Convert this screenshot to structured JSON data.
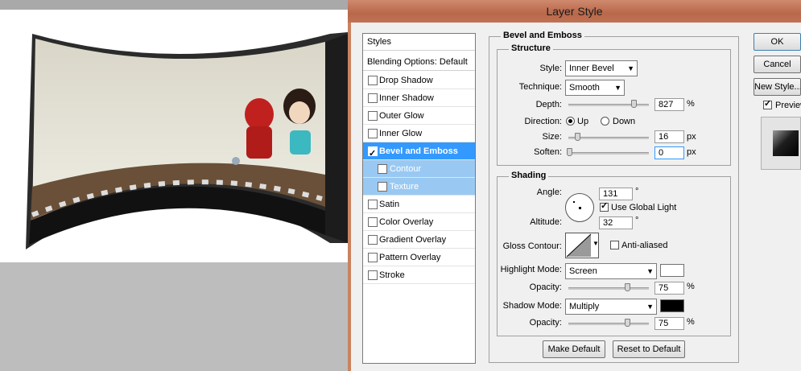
{
  "dialog": {
    "title": "Layer Style",
    "ok_label": "OK",
    "cancel_label": "Cancel",
    "new_style_label": "New Style...",
    "preview_label": "Preview",
    "make_default_label": "Make Default",
    "reset_default_label": "Reset to Default"
  },
  "styles_list": {
    "header": "Styles",
    "blending": "Blending Options: Default",
    "items": [
      {
        "label": "Drop Shadow",
        "checked": false
      },
      {
        "label": "Inner Shadow",
        "checked": false
      },
      {
        "label": "Outer Glow",
        "checked": false
      },
      {
        "label": "Inner Glow",
        "checked": false
      },
      {
        "label": "Bevel and Emboss",
        "checked": true,
        "selected": true
      },
      {
        "label": "Contour",
        "checked": false,
        "sub": true
      },
      {
        "label": "Texture",
        "checked": false,
        "sub": true
      },
      {
        "label": "Satin",
        "checked": false
      },
      {
        "label": "Color Overlay",
        "checked": false
      },
      {
        "label": "Gradient Overlay",
        "checked": false
      },
      {
        "label": "Pattern Overlay",
        "checked": false
      },
      {
        "label": "Stroke",
        "checked": false
      }
    ]
  },
  "bevel": {
    "group_title": "Bevel and Emboss",
    "structure_title": "Structure",
    "style_label": "Style:",
    "style_value": "Inner Bevel",
    "technique_label": "Technique:",
    "technique_value": "Smooth",
    "depth_label": "Depth:",
    "depth_value": "827",
    "depth_unit": "%",
    "direction_label": "Direction:",
    "dir_up": "Up",
    "dir_down": "Down",
    "size_label": "Size:",
    "size_value": "16",
    "size_unit": "px",
    "soften_label": "Soften:",
    "soften_value": "0",
    "soften_unit": "px"
  },
  "shading": {
    "title": "Shading",
    "angle_label": "Angle:",
    "angle_value": "131",
    "angle_unit": "°",
    "global_light_label": "Use Global Light",
    "altitude_label": "Altitude:",
    "altitude_value": "32",
    "altitude_unit": "°",
    "gloss_label": "Gloss Contour:",
    "anti_aliased_label": "Anti-aliased",
    "highlight_mode_label": "Highlight Mode:",
    "highlight_mode_value": "Screen",
    "highlight_color": "#ffffff",
    "highlight_opacity_label": "Opacity:",
    "highlight_opacity_value": "75",
    "highlight_opacity_unit": "%",
    "shadow_mode_label": "Shadow Mode:",
    "shadow_mode_value": "Multiply",
    "shadow_color": "#000000",
    "shadow_opacity_label": "Opacity:",
    "shadow_opacity_value": "75",
    "shadow_opacity_unit": "%"
  },
  "colors": {
    "title_bar": "#c07356",
    "selection": "#3399ff",
    "sub_selection": "#99c9f3"
  }
}
